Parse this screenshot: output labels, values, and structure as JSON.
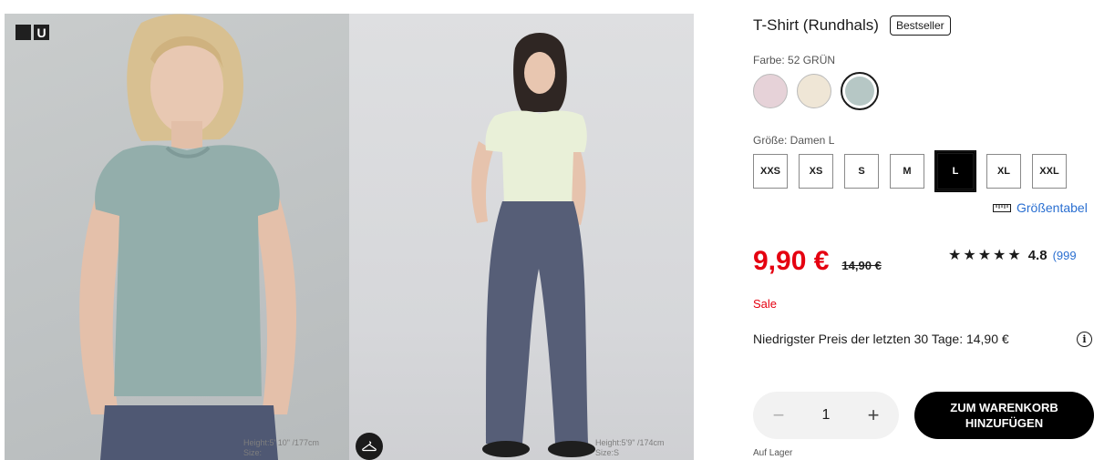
{
  "gallery": {
    "logo_top_text": "ユニ\nクロ",
    "logo_u": "U",
    "photo1_caption": "Height:5' 10\" /177cm",
    "photo1_caption2": "Size:",
    "photo2_caption": "Height:5'9\" /174cm",
    "photo2_caption2": "Size:S",
    "hanger_icon": "hanger-icon"
  },
  "product": {
    "title": "T-Shirt (Rundhals)",
    "badge": "Bestseller",
    "color_label": "Farbe: 52 GRÜN",
    "colors": [
      {
        "name": "pink",
        "hex": "#e6d2d8"
      },
      {
        "name": "beige",
        "hex": "#efe6d6"
      },
      {
        "name": "green",
        "hex": "#b6c7c5"
      }
    ],
    "selected_color": 2,
    "size_label": "Größe: Damen L",
    "sizes": [
      "XXS",
      "XS",
      "S",
      "M",
      "L",
      "XL",
      "XXL"
    ],
    "selected_size": "L",
    "size_chart_label": "Größentabel",
    "price": "9,90 €",
    "old_price": "14,90 €",
    "rating_stars": "★★★★★",
    "rating_value": "4.8",
    "rating_count": "(999",
    "sale_label": "Sale",
    "lowest_price_text": "Niedrigster Preis der letzten 30 Tage: 14,90 €",
    "quantity": "1",
    "minus": "−",
    "plus": "+",
    "add_to_cart": "ZUM WARENKORB\nHINZUFÜGEN",
    "stock": "Auf Lager"
  },
  "colors": {
    "price_red": "#e50010",
    "link_blue": "#2a6fd1"
  }
}
